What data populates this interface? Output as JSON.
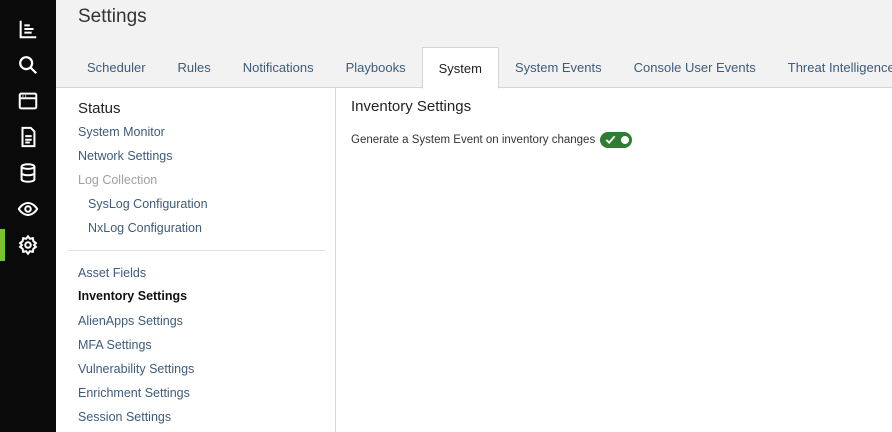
{
  "rail": {
    "icons": [
      "dashboard-icon",
      "search-icon",
      "browser-window-icon",
      "document-icon",
      "database-icon",
      "eye-icon",
      "gear-icon"
    ],
    "active_index": 6,
    "accent_color": "#7ac231"
  },
  "header": {
    "title": "Settings",
    "tabs": [
      {
        "label": "Scheduler"
      },
      {
        "label": "Rules"
      },
      {
        "label": "Notifications"
      },
      {
        "label": "Playbooks"
      },
      {
        "label": "System",
        "active": true
      },
      {
        "label": "System Events"
      },
      {
        "label": "Console User Events"
      },
      {
        "label": "Threat Intelligence"
      }
    ]
  },
  "subnav": {
    "heading": "Status",
    "items": [
      {
        "label": "System Monitor"
      },
      {
        "label": "Network Settings"
      },
      {
        "label": "Log Collection",
        "disabled": true
      },
      {
        "label": "SysLog Configuration",
        "indent": true
      },
      {
        "label": "NxLog Configuration",
        "indent": true
      },
      {
        "label": "Asset Fields"
      },
      {
        "label": "Inventory Settings",
        "current": true
      },
      {
        "label": "AlienApps Settings"
      },
      {
        "label": "MFA Settings"
      },
      {
        "label": "Vulnerability Settings"
      },
      {
        "label": "Enrichment Settings"
      },
      {
        "label": "Session Settings"
      }
    ]
  },
  "main": {
    "title": "Inventory Settings",
    "setting_label": "Generate a System Event on inventory changes",
    "toggle_on": true,
    "toggle_color": "#2e7d32"
  }
}
